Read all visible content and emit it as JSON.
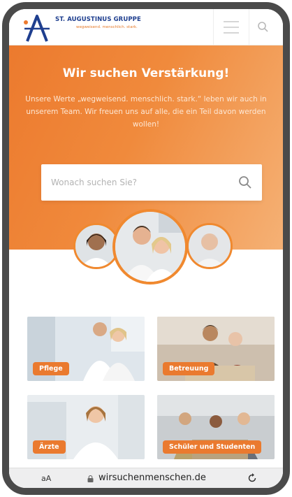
{
  "header": {
    "logo_title": "ST. AUGUSTINUS GRUPPE",
    "logo_subtitle": "wegweisend. menschlich. stark."
  },
  "hero": {
    "title": "Wir suchen Verstärkung!",
    "text": "Unsere Werte „wegweisend. menschlich. stark.“ leben wir auch in unserem Team. Wir freuen uns auf alle, die ein Teil davon werden wollen!",
    "search_placeholder": "Wonach suchen Sie?"
  },
  "tiles": [
    {
      "label": "Pflege"
    },
    {
      "label": "Betreuung"
    },
    {
      "label": "Ärzte"
    },
    {
      "label": "Schüler und Studenten"
    }
  ],
  "urlbar": {
    "text_size_label": "aA",
    "url": "wirsuchenmenschen.de"
  },
  "colors": {
    "accent": "#ec7a2e",
    "brand_blue": "#1f3f8f"
  }
}
